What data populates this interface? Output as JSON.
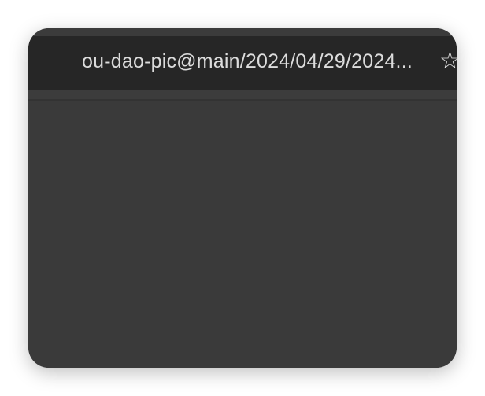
{
  "address_bar": {
    "url_text": "ou-dao-pic@main/2024/04/29/2024...",
    "bookmark_icon": "star-outline-icon"
  },
  "colors": {
    "toolbar": "#262626",
    "content": "#3a3a3a",
    "text": "#dcdcdc"
  }
}
